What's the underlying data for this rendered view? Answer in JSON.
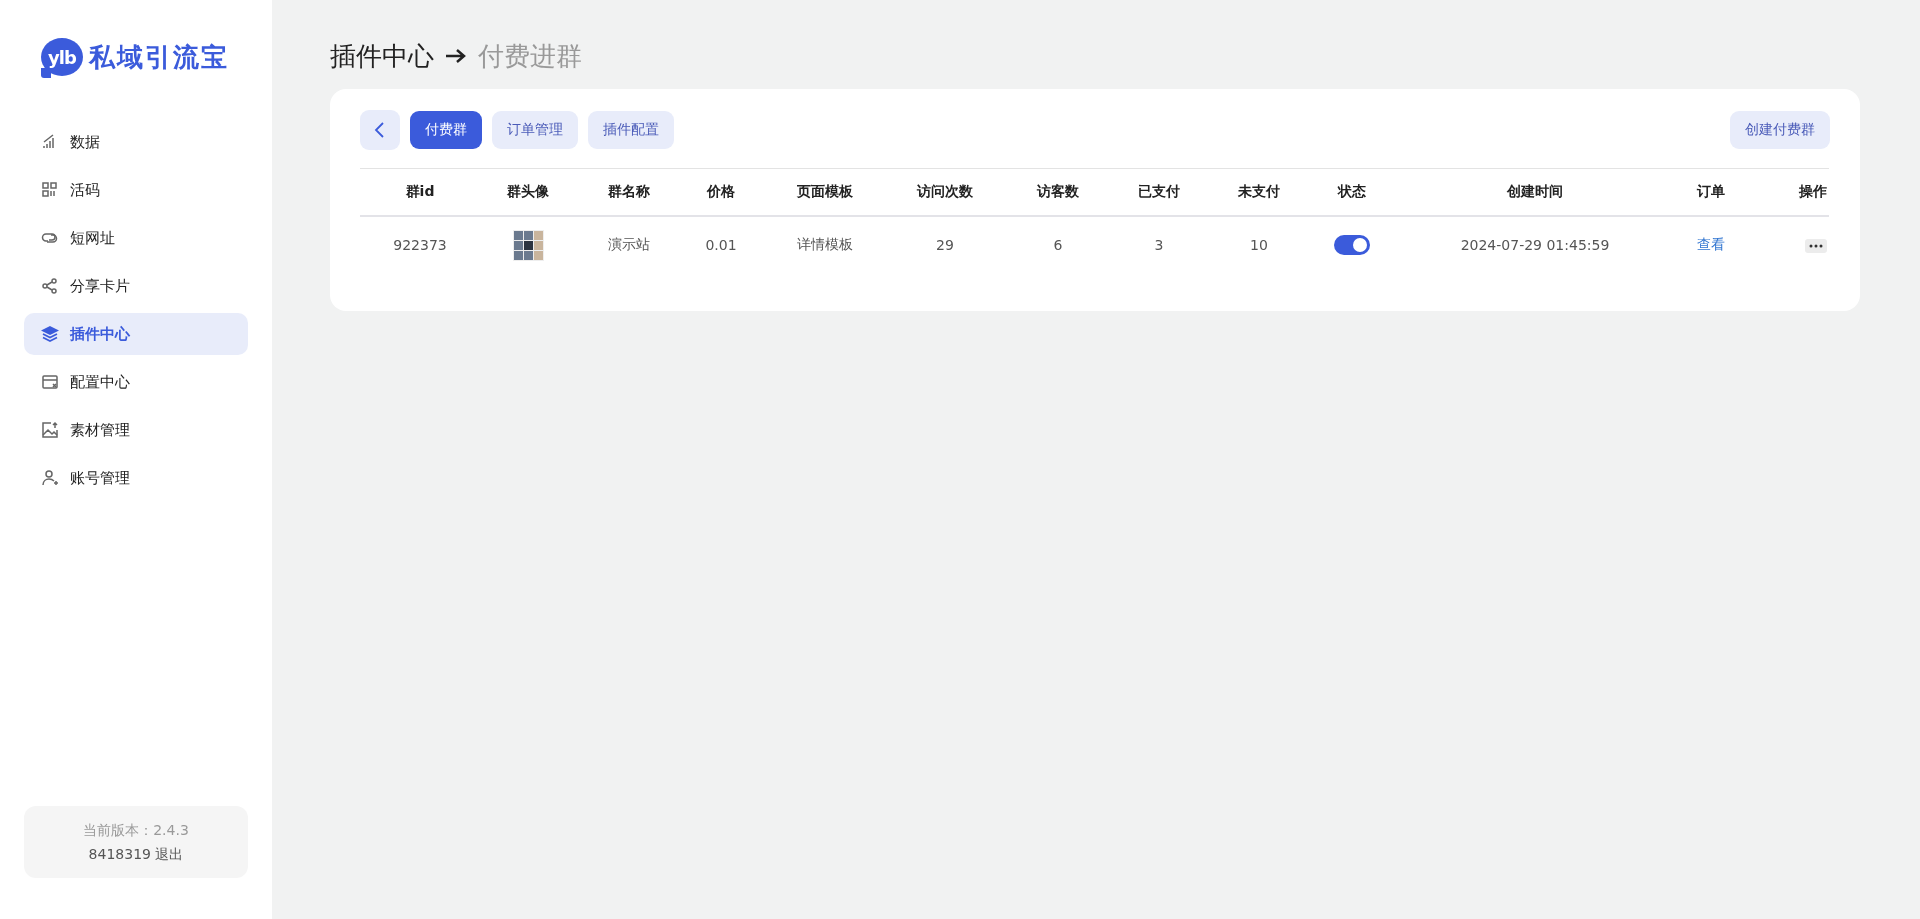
{
  "logo": {
    "badge": "ylb",
    "name": "私域引流宝"
  },
  "sidebar": {
    "items": [
      {
        "label": "数据",
        "selected": false
      },
      {
        "label": "活码",
        "selected": false
      },
      {
        "label": "短网址",
        "selected": false
      },
      {
        "label": "分享卡片",
        "selected": false
      },
      {
        "label": "插件中心",
        "selected": true
      },
      {
        "label": "配置中心",
        "selected": false
      },
      {
        "label": "素材管理",
        "selected": false
      },
      {
        "label": "账号管理",
        "selected": false
      }
    ]
  },
  "footer": {
    "version": "当前版本：2.4.3",
    "account": "8418319",
    "logout": "退出"
  },
  "breadcrumb": {
    "parent": "插件中心",
    "current": "付费进群"
  },
  "tabs": [
    {
      "label": "付费群",
      "selected": true
    },
    {
      "label": "订单管理",
      "selected": false
    },
    {
      "label": "插件配置",
      "selected": false
    }
  ],
  "create_button": "创建付费群",
  "table": {
    "columns": [
      "群id",
      "群头像",
      "群名称",
      "价格",
      "页面模板",
      "访问次数",
      "访客数",
      "已支付",
      "未支付",
      "状态",
      "创建时间",
      "订单",
      "操作"
    ],
    "rows": [
      {
        "id": "922373",
        "name": "演示站",
        "price": "0.01",
        "template": "详情模板",
        "visits": "29",
        "visitors": "6",
        "paid": "3",
        "unpaid": "10",
        "enabled": true,
        "created": "2024-07-29 01:45:59",
        "orders_link": "查看"
      }
    ]
  }
}
